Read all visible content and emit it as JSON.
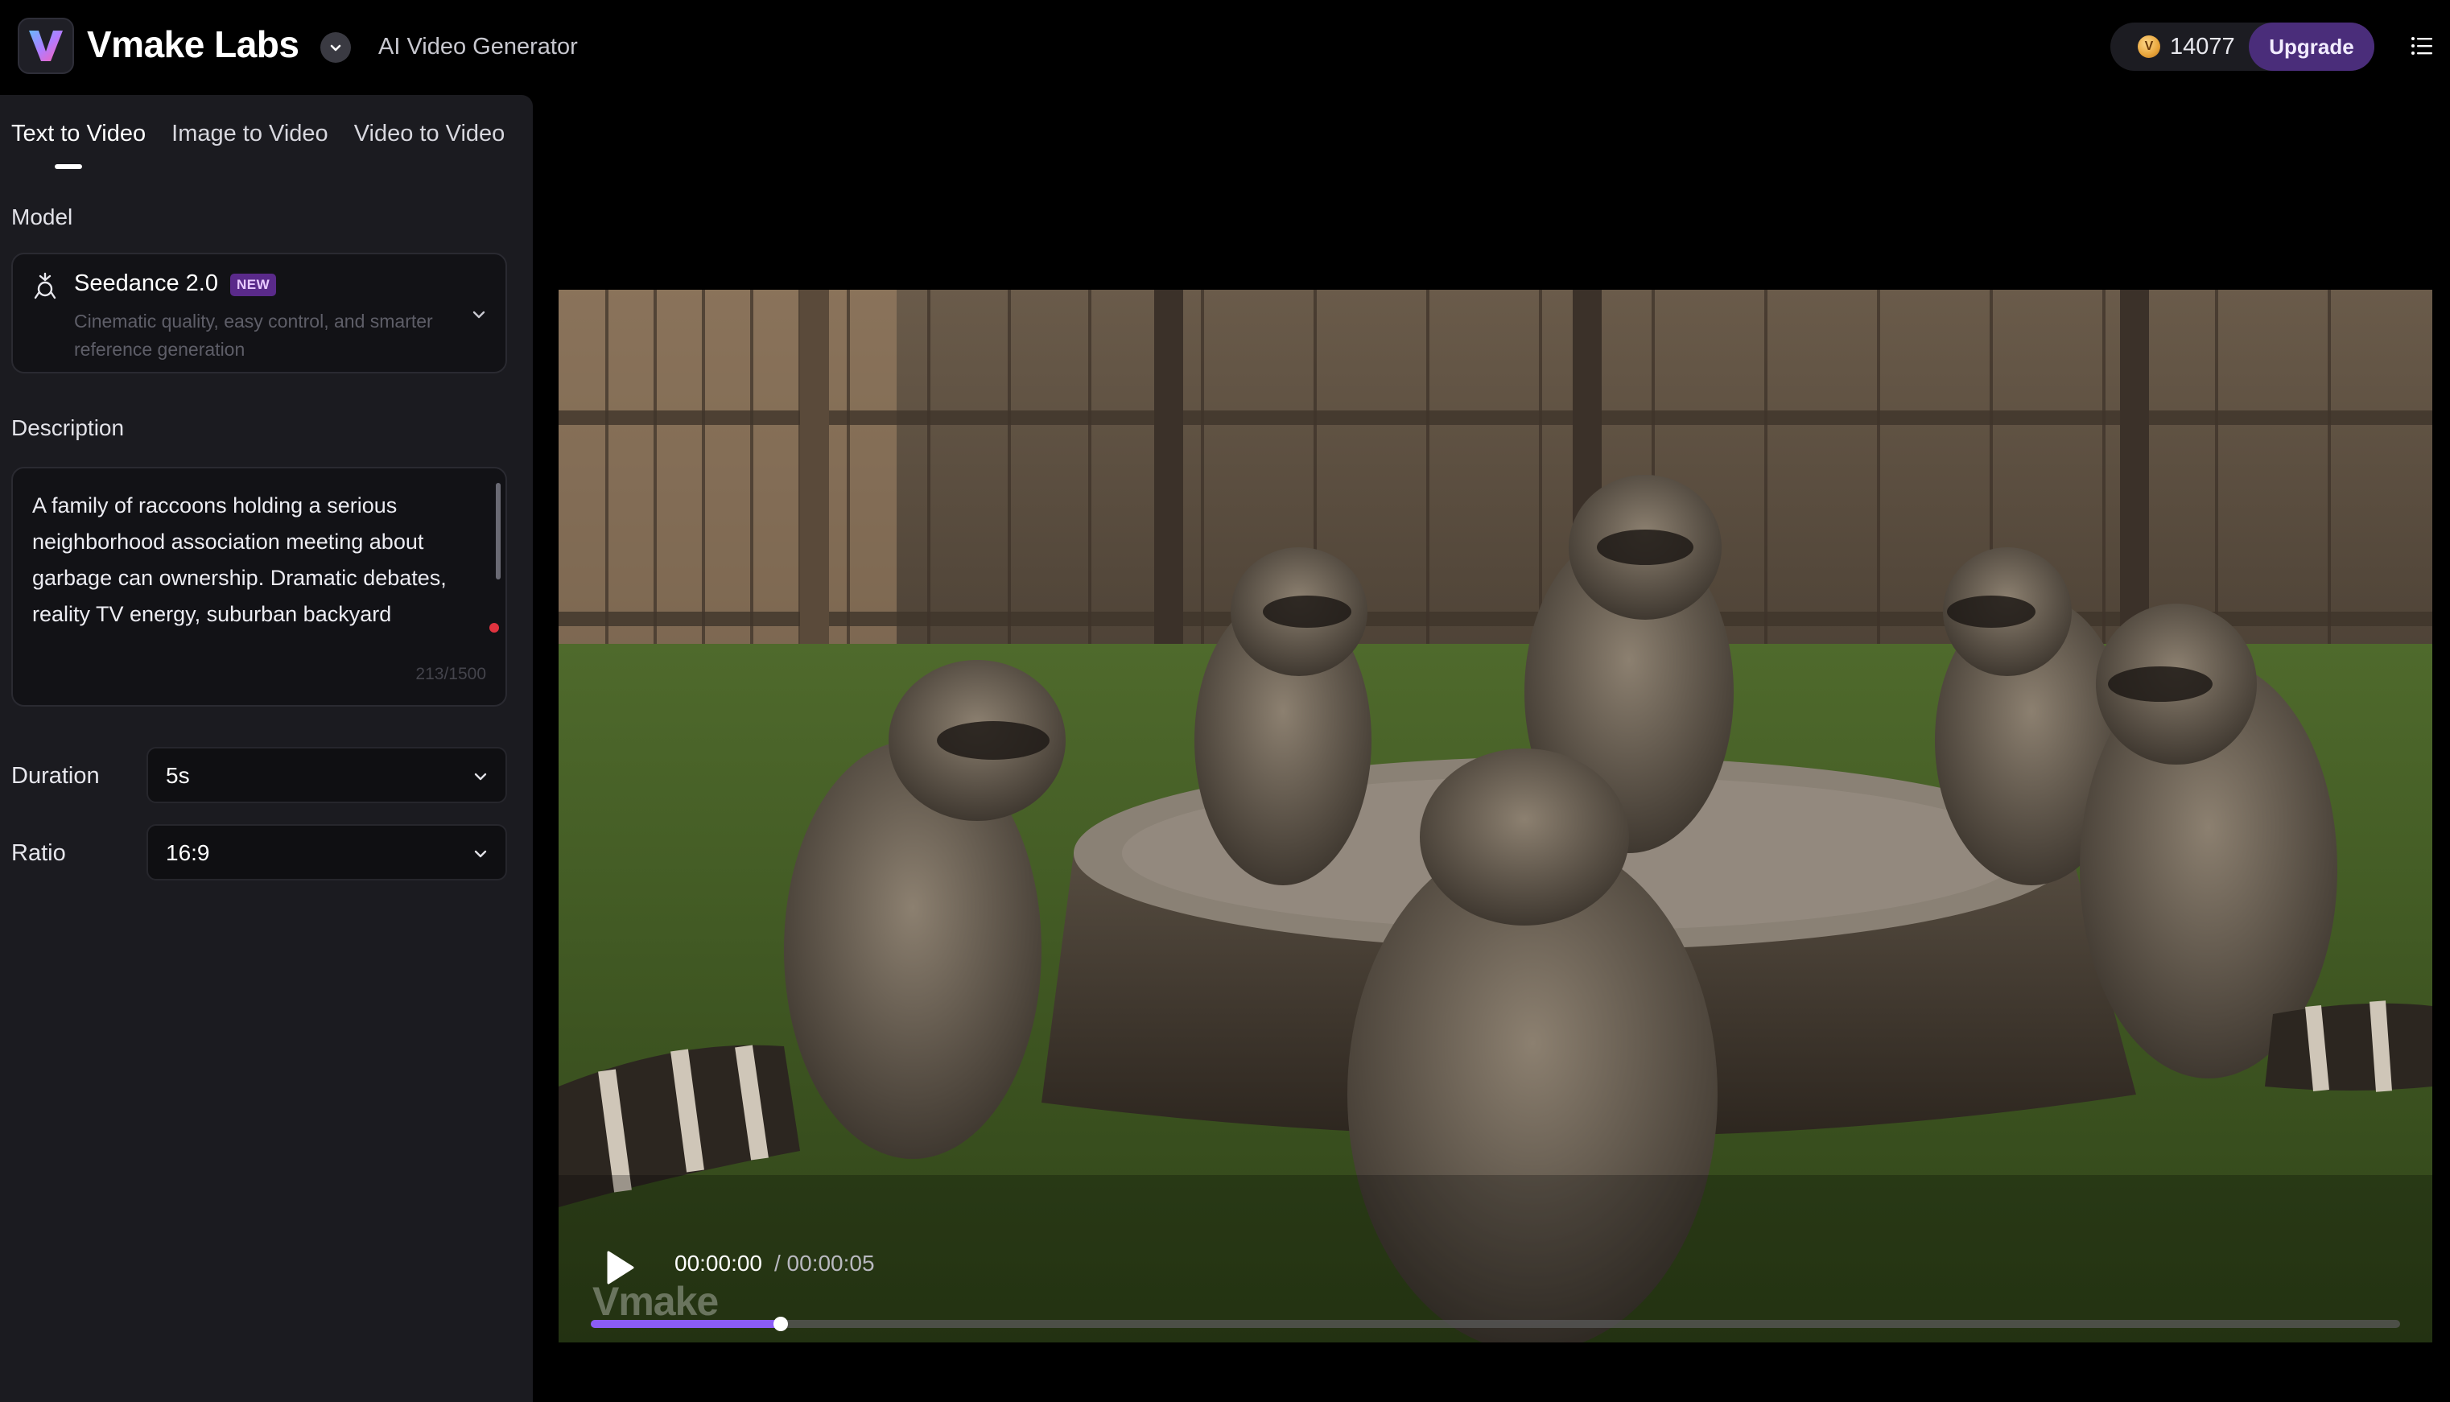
{
  "header": {
    "brand": "Vmake Labs",
    "subtitle": "AI Video Generator",
    "credits": "14077",
    "upgrade_label": "Upgrade",
    "icons": [
      "vmake-logo-icon",
      "chevron-down-icon",
      "coin-icon",
      "menu-list-icon"
    ]
  },
  "tabs": [
    {
      "label": "Text to Video",
      "active": true
    },
    {
      "label": "Image to Video",
      "active": false
    },
    {
      "label": "Video to Video",
      "active": false
    }
  ],
  "model": {
    "section_label": "Model",
    "name": "Seedance 2.0",
    "badge": "NEW",
    "description": "Cinematic quality, easy control, and smarter reference generation"
  },
  "description": {
    "section_label": "Description",
    "text": "A family of raccoons holding a serious neighborhood association meeting about garbage can ownership. Dramatic debates, reality TV energy, suburban backyard",
    "counter": "213/1500"
  },
  "duration": {
    "label": "Duration",
    "value": "5s"
  },
  "ratio": {
    "label": "Ratio",
    "value": "16:9"
  },
  "player": {
    "current_time": "00:00:00",
    "total_time": "/ 00:00:05",
    "watermark": "Vmake",
    "progress": 0.105
  },
  "colors": {
    "accent": "#8b5cf6",
    "upgrade_bg": "#4a2d7a",
    "sidebar_bg": "#1b1b20",
    "badge_bg": "#5a2a8a"
  }
}
